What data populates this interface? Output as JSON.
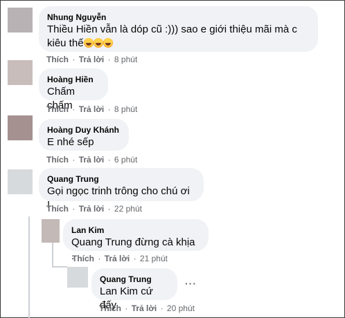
{
  "actions": {
    "like": "Thích",
    "reply": "Trả lời",
    "sep": "·"
  },
  "comments": [
    {
      "name": "Nhung Nguyễn",
      "text_line1": "Thiều Hiền vẫn là dóp cũ :))) sao e giới thiệu mãi mà c",
      "text_line2": "kiêu thế",
      "emoji": "rolling-on-floor-laughing",
      "time": "8 phút",
      "avatar_color": "#b9b2b4"
    },
    {
      "name": "Hoàng Hiền",
      "text": "Chấm chấm",
      "time": "8 phút",
      "avatar_color": "#c8bdbb"
    },
    {
      "name": "Hoàng Duy Khánh",
      "text": "E nhé sếp",
      "time": "6 phút",
      "avatar_color": "#a49190"
    },
    {
      "name": "Quang Trung",
      "text": "Gọi ngọc trinh trông cho chú ơi !",
      "time": "22 phút",
      "avatar_color": "#d7dadd"
    },
    {
      "name": "Lan Kim",
      "tag": "Quang Trung",
      "text": " đừng cà khịa .",
      "time": "21 phút",
      "avatar_color": "#c3b9b6"
    },
    {
      "name": "Quang Trung",
      "tag": "Lan Kim",
      "text": " cứ đấy",
      "time": "20 phút",
      "avatar_color": "#d7dadd",
      "more": "···"
    }
  ]
}
